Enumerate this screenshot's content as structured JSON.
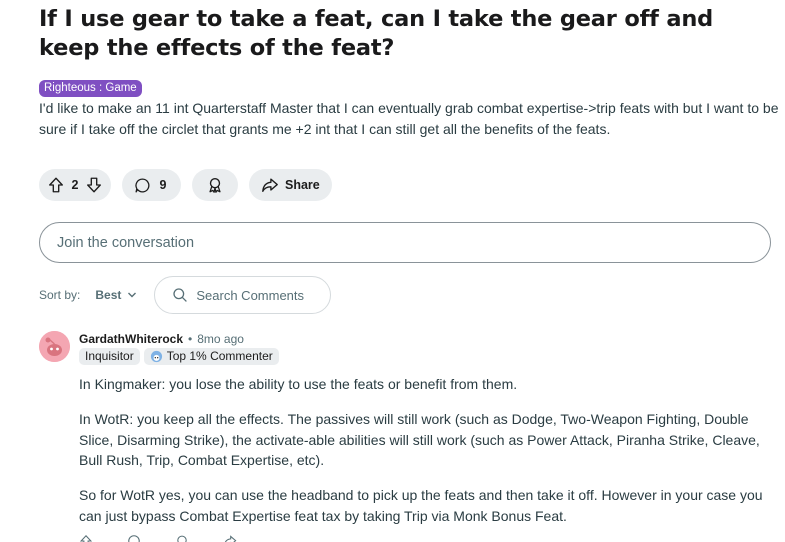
{
  "post": {
    "title": "If I use gear to take a feat, can I take the gear off and keep the effects of the feat?",
    "flair": "Righteous : Game",
    "body": "I'd like to make an 11 int Quarterstaff Master that I can eventually grab combat expertise->trip feats with but I want to be sure if I take off the circlet that grants me +2 int that I can still get all the benefits of the feats."
  },
  "actions": {
    "upvote_icon": "upvote-arrow-icon",
    "score": "2",
    "downvote_icon": "downvote-arrow-icon",
    "comments_icon": "speech-bubble-icon",
    "comments_count": "9",
    "award_icon": "award-ribbon-icon",
    "share_icon": "share-arrow-icon",
    "share_label": "Share"
  },
  "composer": {
    "placeholder": "Join the conversation"
  },
  "sort": {
    "label": "Sort by:",
    "value": "Best",
    "search_placeholder": "Search Comments"
  },
  "comment": {
    "author": "GardathWhiterock",
    "separator": "•",
    "age": "8mo ago",
    "flair": "Inquisitor",
    "badge": "Top 1% Commenter",
    "paragraphs": [
      "In Kingmaker: you lose the ability to use the feats or benefit from them.",
      "In WotR: you keep all the effects. The passives will still work (such as Dodge, Two-Weapon Fighting, Double Slice, Disarming Strike), the activate-able abilities will still work (such as Power Attack, Piranha Strike, Cleave, Bull Rush, Trip, Combat Expertise, etc).",
      "So for WotR yes, you can use the headband to pick up the feats and then take it off. However in your case you can just bypass Combat Expertise feat tax by taking Trip via Monk Bonus Feat."
    ]
  },
  "colors": {
    "flair_bg": "#7f4fc2",
    "pill_bg": "#eaedef",
    "avatar_bg": "#f4a6b2",
    "muted_text": "#576f76"
  }
}
